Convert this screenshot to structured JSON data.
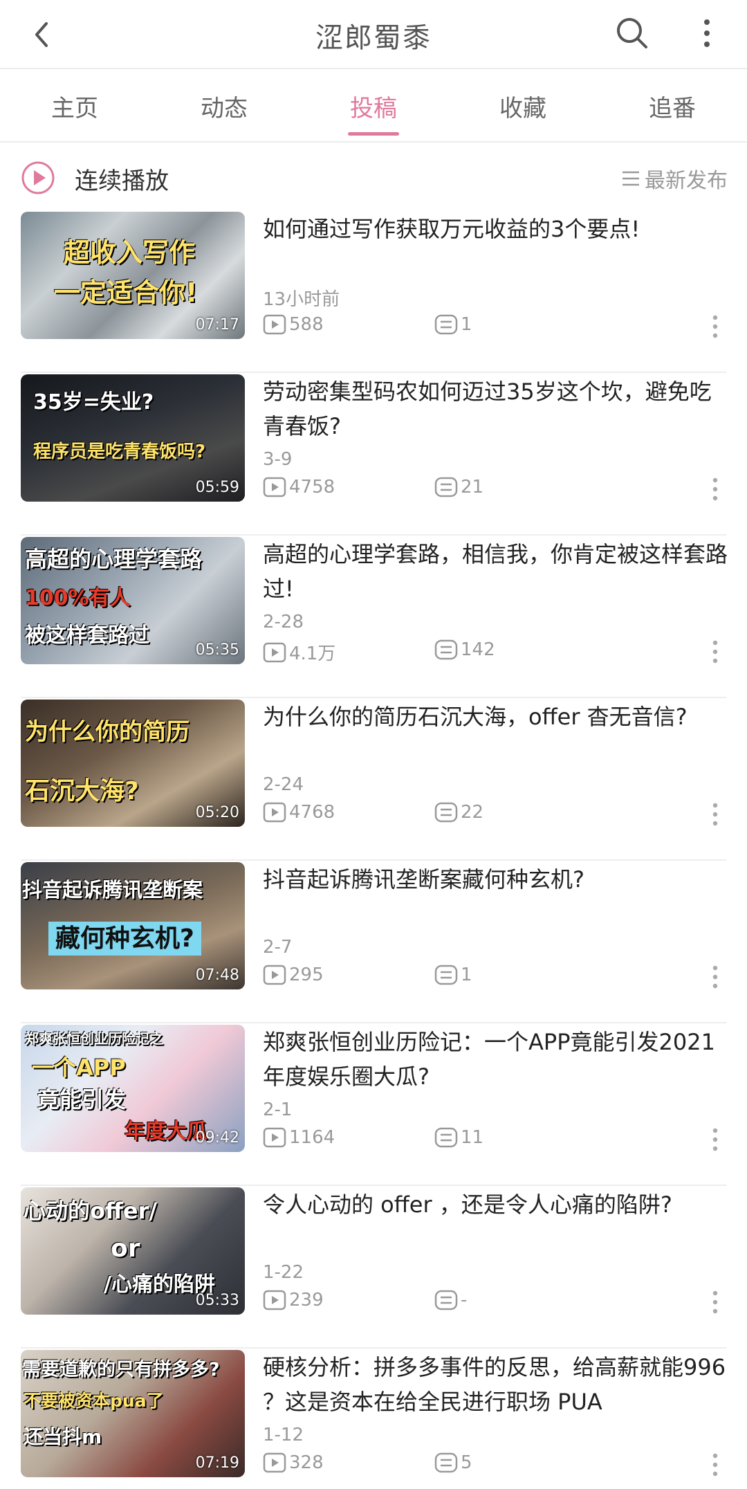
{
  "header": {
    "title": "涩郎蜀黍"
  },
  "tabs": [
    {
      "label": "主页",
      "active": false
    },
    {
      "label": "动态",
      "active": false
    },
    {
      "label": "投稿",
      "active": true
    },
    {
      "label": "收藏",
      "active": false
    },
    {
      "label": "追番",
      "active": false
    }
  ],
  "playbar": {
    "label": "连续播放",
    "sort_label": "最新发布"
  },
  "colors": {
    "accent": "#e07a9b",
    "muted": "#999999"
  },
  "videos": [
    {
      "title": "如何通过写作获取万元收益的3个要点!",
      "date": "13小时前",
      "plays": "588",
      "comments": "1",
      "duration": "07:17",
      "thumb_lines": [
        "超收入写作",
        "一定适合你!"
      ]
    },
    {
      "title": "劳动密集型码农如何迈过35岁这个坎，避免吃青春饭?",
      "date": "3-9",
      "plays": "4758",
      "comments": "21",
      "duration": "05:59",
      "thumb_lines": [
        "35岁=失业?",
        "程序员是吃青春饭吗?"
      ]
    },
    {
      "title": "高超的心理学套路，相信我，你肯定被这样套路过!",
      "date": "2-28",
      "plays": "4.1万",
      "comments": "142",
      "duration": "05:35",
      "thumb_lines": [
        "高超的心理学套路",
        "100%有人",
        "被这样套路过"
      ]
    },
    {
      "title": "为什么你的简历石沉大海，offer  杳无音信?",
      "date": "2-24",
      "plays": "4768",
      "comments": "22",
      "duration": "05:20",
      "thumb_lines": [
        "为什么你的简历",
        "石沉大海?"
      ]
    },
    {
      "title": "抖音起诉腾讯垄断案藏何种玄机?",
      "date": "2-7",
      "plays": "295",
      "comments": "1",
      "duration": "07:48",
      "thumb_lines": [
        "抖音起诉腾讯垄断案",
        "藏何种玄机?"
      ]
    },
    {
      "title": "郑爽张恒创业历险记：一个APP竟能引发2021年度娱乐圈大瓜?",
      "date": "2-1",
      "plays": "1164",
      "comments": "11",
      "duration": "09:42",
      "thumb_lines": [
        "郑爽张恒创业历险记之",
        "一个APP",
        "竟能引发",
        "年度大瓜"
      ]
    },
    {
      "title": "令人心动的  offer  ，还是令人心痛的陷阱?",
      "date": "1-22",
      "plays": "239",
      "comments": "-",
      "duration": "05:33",
      "thumb_lines": [
        "心动的offer/",
        "or",
        "/心痛的陷阱"
      ]
    },
    {
      "title": "硬核分析：拼多多事件的反思，给高薪就能996  ？这是资本在给全民进行职场  PUA",
      "date": "1-12",
      "plays": "328",
      "comments": "5",
      "duration": "07:19",
      "thumb_lines": [
        "需要道歉的只有拼多多?",
        "不要被资本pua了",
        "还当抖m"
      ]
    }
  ]
}
